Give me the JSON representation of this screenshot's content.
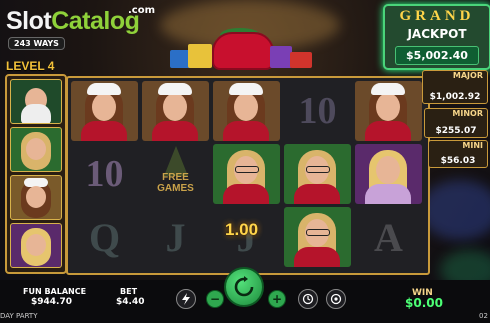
{
  "logo": {
    "part1": "Slot",
    "part2": "Catalog",
    "suffix": ".com"
  },
  "ways_badge": "243 WAYS",
  "level": "LEVEL 4",
  "jackpots": {
    "grand_title": "GRAND",
    "grand_subtitle": "JACKPOT",
    "grand_value": "$5,002.40",
    "major_label": "MAJOR",
    "major_value": "$1,002.92",
    "minor_label": "MINOR",
    "minor_value": "$255.07",
    "mini_label": "MINI",
    "mini_value": "$56.03"
  },
  "reels": {
    "grid": [
      [
        "santa-girl",
        "ten",
        "q"
      ],
      [
        "santa-girl",
        "free-games",
        "j"
      ],
      [
        "santa-girl",
        "glasses-girl",
        "j"
      ],
      [
        "ten",
        "glasses-girl",
        "glasses-girl"
      ],
      [
        "santa-girl",
        "blonde-girl",
        "a"
      ]
    ],
    "ten_text": "10",
    "q_text": "Q",
    "j_text": "J",
    "a_text": "A",
    "free_games_line1": "FREE",
    "free_games_line2": "GAMES",
    "win_popup": "1.00"
  },
  "bottom_bar": {
    "balance_label": "FUN BALANCE",
    "balance_value": "$944.70",
    "bet_label": "BET",
    "bet_value": "$4.40",
    "minus_label": "−",
    "plus_label": "+",
    "win_label": "WIN",
    "win_value": "$0.00",
    "game_name": "DAY PARTY",
    "clock": "02"
  },
  "colors": {
    "frame_gold": "#c99a3b",
    "win_green": "#4cff75",
    "spin_green": "#2fa84f",
    "jackpot_gold": "#ffd54a"
  }
}
